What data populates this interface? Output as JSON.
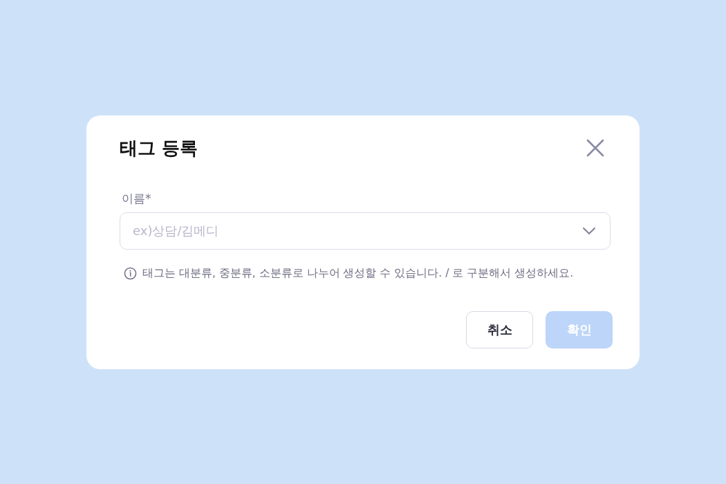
{
  "dialog": {
    "title": "태그 등록"
  },
  "field": {
    "label": "이름*",
    "placeholder": "ex)상담/김메디"
  },
  "hint": "태그는 대분류, 중분류, 소분류로 나누어 생성할 수 있습니다. / 로 구분해서 생성하세요.",
  "buttons": [
    {
      "label": "취소",
      "kind": "secondary",
      "disabled": false
    },
    {
      "label": "확인",
      "kind": "primary",
      "disabled": true
    }
  ]
}
